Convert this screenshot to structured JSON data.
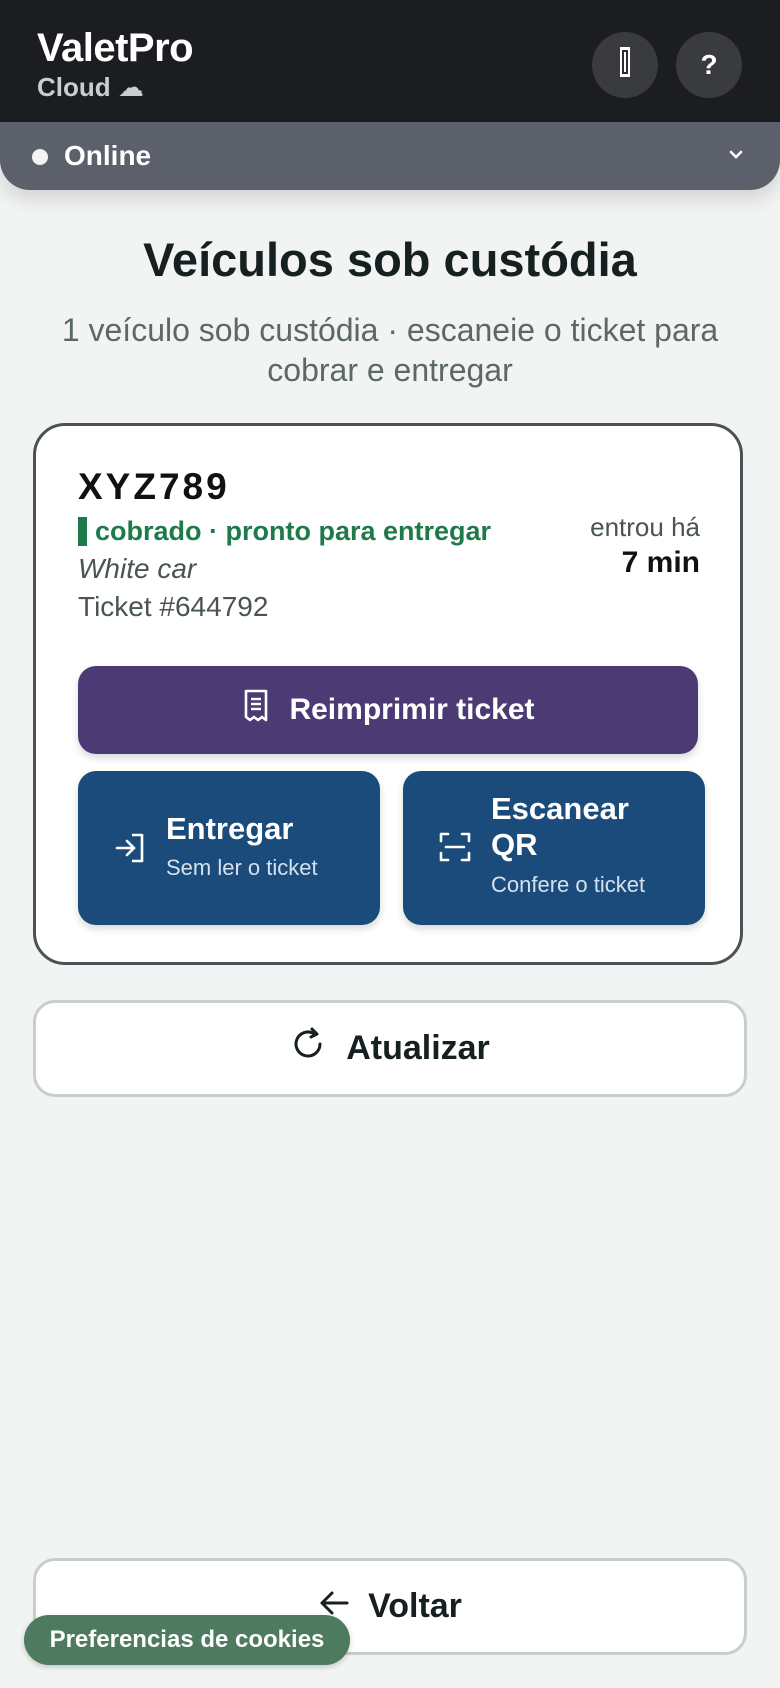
{
  "app": {
    "name": "ValetPro",
    "subtitle": "Cloud ☁"
  },
  "header": {
    "help_label": "?"
  },
  "status": {
    "label": "Online"
  },
  "page": {
    "title": "Veículos sob custódia",
    "subtitle": "1 veículo sob custódia · escaneie o ticket para cobrar e entregar"
  },
  "vehicle": {
    "plate": "XYZ789",
    "status": "cobrado · pronto para entregar",
    "description": "White car",
    "ticket": "Ticket #644792",
    "entered_label": "entrou há",
    "entered_value": "7 min"
  },
  "actions": {
    "reprint": "Reimprimir ticket",
    "deliver_title": "Entregar",
    "deliver_sub": "Sem ler o ticket",
    "scan_title": "Escanear QR",
    "scan_sub": "Confere o ticket"
  },
  "refresh_label": "Atualizar",
  "back_label": "Voltar",
  "cookie_label": "Preferencias de cookies",
  "colors": {
    "header_bg": "#1c1d20",
    "status_bar_bg": "#5c606a",
    "reprint_bg": "#4b3a73",
    "action_bg": "#1b4b7a",
    "status_green": "#1f7a4b",
    "cookie_bg": "#4e7a60"
  },
  "icons": {
    "menu": "signal-icon",
    "deliver": "enter-icon",
    "scan": "scan-icon",
    "reprint": "receipt-icon",
    "refresh": "refresh-icon",
    "back": "arrow-left-icon"
  }
}
